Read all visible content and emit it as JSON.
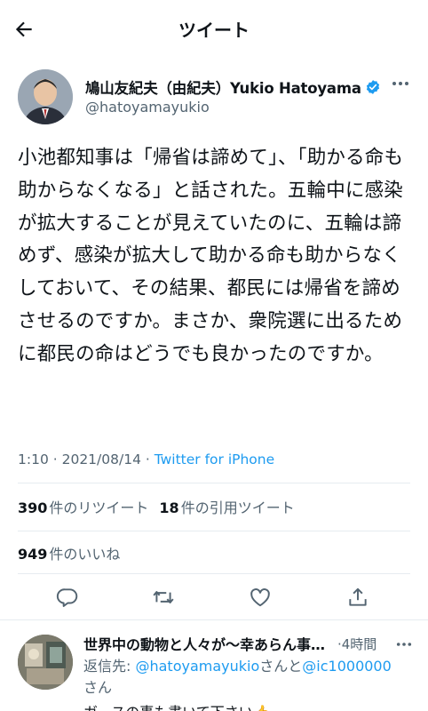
{
  "header": {
    "title": "ツイート"
  },
  "author": {
    "name": "鳩山友紀夫（由紀夫）Yukio Hatoyama",
    "handle": "@hatoyamayukio",
    "verified_color": "#1d9bf0"
  },
  "tweet": {
    "text": "小池都知事は「帰省は諦めて」、「助かる命も助からなくなる」と話された。五輪中に感染が拡大することが見えていたのに、五輪は諦めず、感染が拡大して助かる命も助からなくしておいて、その結果、都民には帰省を諦めさせるのですか。まさか、衆院選に出るために都民の命はどうでも良かったのですか。",
    "time": "1:10",
    "date": "2021/08/14",
    "separator": " · ",
    "source": "Twitter for iPhone"
  },
  "stats": {
    "retweets_count": "390",
    "retweets_label": "件のリツイート",
    "quotes_count": "18",
    "quotes_label": "件の引用ツイート",
    "likes_count": "949",
    "likes_label": "件のいいね"
  },
  "actions": [
    "reply-icon",
    "retweet-icon",
    "like-icon",
    "share-icon"
  ],
  "reply": {
    "name": "世界中の動物と人々が〜幸あらん事を・・・",
    "time": "·4時間",
    "replying_prefix": "返信先: ",
    "mention1": "@hatoyamayukio",
    "middle": "さんと",
    "mention2": "@ic1000000",
    "suffix": "さん",
    "body": "ガースの事も書いて下さい👍"
  },
  "colors": {
    "accent": "#1d9bf0",
    "secondary_text": "#536471",
    "divider": "#e6ecf0"
  }
}
